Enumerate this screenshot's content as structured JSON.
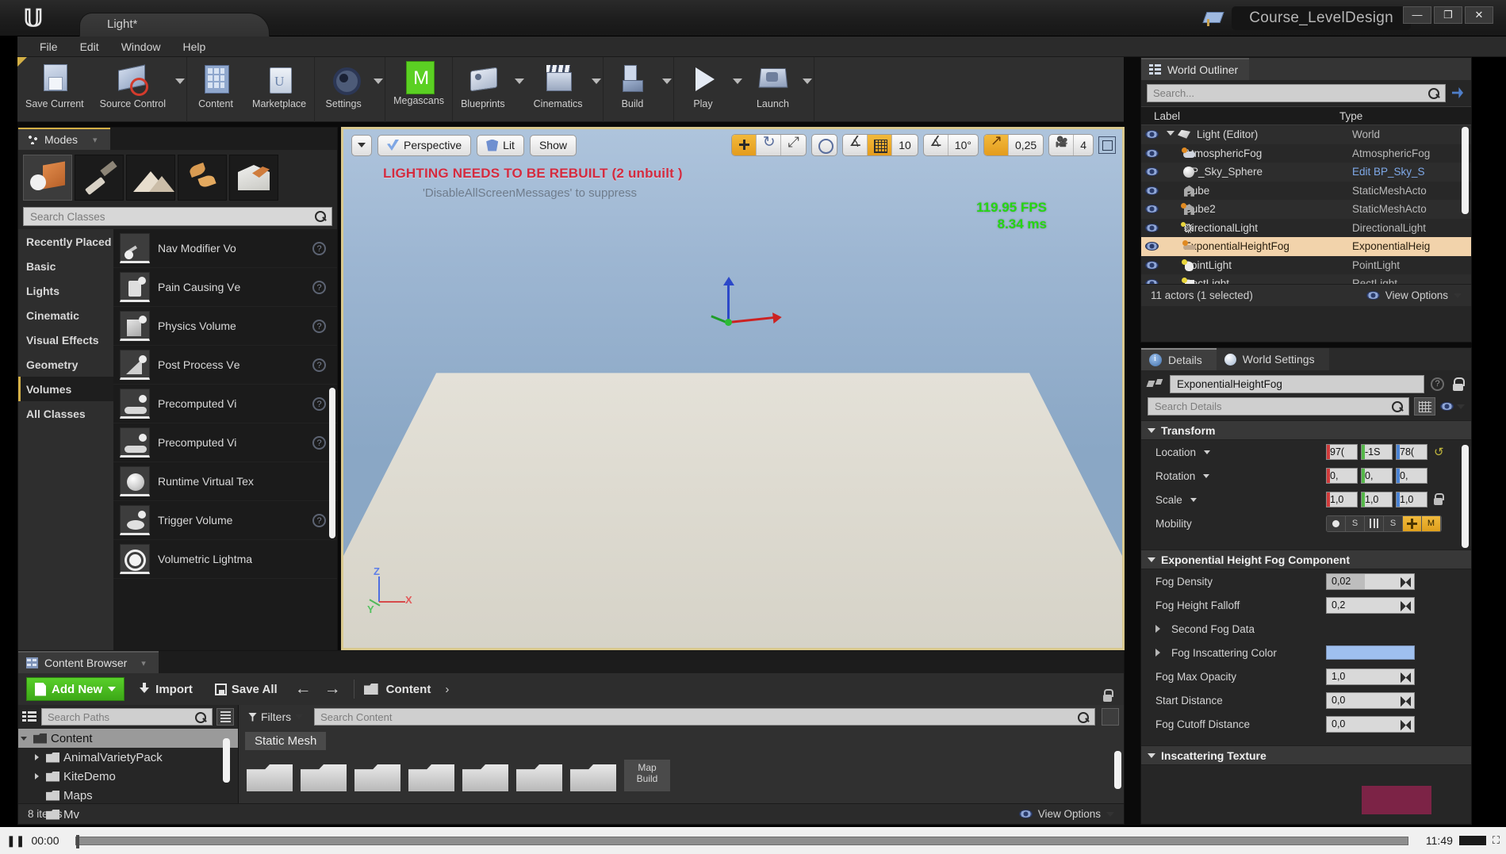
{
  "window": {
    "tab_label": "Light*",
    "project_title": "Course_LevelDesign",
    "minimize": "—",
    "maximize": "❐",
    "close": "✕"
  },
  "menubar": {
    "items": [
      "File",
      "Edit",
      "Window",
      "Help"
    ]
  },
  "toolbar": {
    "items": [
      {
        "label": "Save Current",
        "icon": "save-icon",
        "arrow": false
      },
      {
        "label": "Source Control",
        "icon": "source-control-icon",
        "arrow": true
      },
      {
        "label": "Content",
        "icon": "content-icon",
        "arrow": false
      },
      {
        "label": "Marketplace",
        "icon": "marketplace-icon",
        "arrow": false
      },
      {
        "label": "Settings",
        "icon": "gear-icon",
        "arrow": true
      },
      {
        "label": "Megascans",
        "icon": "megascans-icon",
        "arrow": false
      },
      {
        "label": "Blueprints",
        "icon": "blueprints-icon",
        "arrow": true
      },
      {
        "label": "Cinematics",
        "icon": "cinematics-icon",
        "arrow": true
      },
      {
        "label": "Build",
        "icon": "build-icon",
        "arrow": true
      },
      {
        "label": "Play",
        "icon": "play-icon",
        "arrow": true
      },
      {
        "label": "Launch",
        "icon": "launch-icon",
        "arrow": true
      }
    ]
  },
  "modes": {
    "tab_label": "Modes",
    "mode_buttons": [
      "place-mode-icon",
      "paint-mode-icon",
      "landscape-mode-icon",
      "foliage-mode-icon",
      "geometry-mode-icon"
    ],
    "active_mode_index": 0,
    "search_placeholder": "Search Classes",
    "categories": [
      "Recently Placed",
      "Basic",
      "Lights",
      "Cinematic",
      "Visual Effects",
      "Geometry",
      "Volumes",
      "All Classes"
    ],
    "selected_category": "Volumes",
    "classes": [
      {
        "name": "Nav Modifier Vo",
        "thumb": "ct-a",
        "help": true
      },
      {
        "name": "Pain Causing Vе",
        "thumb": "ct-b",
        "help": true
      },
      {
        "name": "Physics Volume",
        "thumb": "ct-c",
        "help": true
      },
      {
        "name": "Post Process Vе",
        "thumb": "ct-d",
        "help": true
      },
      {
        "name": "Precomputed Vi",
        "thumb": "ct-e",
        "help": true
      },
      {
        "name": "Precomputed Vi",
        "thumb": "ct-e",
        "help": true
      },
      {
        "name": "Runtime Virtual Teх",
        "thumb": "ct-f",
        "help": false
      },
      {
        "name": "Trigger Volume",
        "thumb": "ct-g",
        "help": true
      },
      {
        "name": "Volumetric Lightma",
        "thumb": "ct-h",
        "help": false
      }
    ]
  },
  "viewport": {
    "view_dropdown": "▾",
    "perspective_label": "Perspective",
    "lit_label": "Lit",
    "show_label": "Show",
    "warning_line1": "LIGHTING NEEDS TO BE REBUILT (2 unbuilt )",
    "warning_line2": "'DisableAllScreenMessages' to suppress",
    "fps": "119.95 FPS",
    "frametime": "8.34 ms",
    "grid_snap_value": "10",
    "angle_snap_value": "10°",
    "scale_snap_value": "0,25",
    "camera_speed_value": "4",
    "axis_z": "Z",
    "axis_x": "X",
    "axis_y": "Y"
  },
  "outliner": {
    "tab_label": "World Outliner",
    "search_placeholder": "Search...",
    "col_label": "Label",
    "col_type": "Type",
    "rows": [
      {
        "label": "Light (Editor)",
        "type": "World",
        "indent": 1,
        "icon": "oi-world",
        "expander": true,
        "selected": false,
        "link": false
      },
      {
        "label": "AtmosphericFog",
        "type": "AtmosphericFog",
        "indent": 2,
        "icon": "oi-fog",
        "expander": false,
        "selected": false,
        "link": false
      },
      {
        "label": "BP_Sky_Sphere",
        "type": "Edit BP_Sky_S",
        "indent": 2,
        "icon": "oi-sphere",
        "expander": false,
        "selected": false,
        "link": true
      },
      {
        "label": "Cube",
        "type": "StaticMeshActo",
        "indent": 2,
        "icon": "oi-mesh",
        "expander": false,
        "selected": false,
        "link": false
      },
      {
        "label": "Cube2",
        "type": "StaticMeshActo",
        "indent": 2,
        "icon": "oi-mesh oi-mesh2",
        "expander": false,
        "selected": false,
        "link": false
      },
      {
        "label": "DirectionalLight",
        "type": "DirectionalLight",
        "indent": 2,
        "icon": "oi-dirl",
        "expander": false,
        "selected": false,
        "link": false
      },
      {
        "label": "ExponentialHeightFog",
        "type": "ExponentialHeig",
        "indent": 2,
        "icon": "oi-expfog",
        "expander": false,
        "selected": true,
        "link": false
      },
      {
        "label": "PointLight",
        "type": "PointLight",
        "indent": 2,
        "icon": "oi-point",
        "expander": false,
        "selected": false,
        "link": false
      },
      {
        "label": "RectLight",
        "type": "RectLight",
        "indent": 2,
        "icon": "oi-rect",
        "expander": false,
        "selected": false,
        "link": false
      }
    ],
    "status": "11 actors (1 selected)",
    "view_options": "View Options"
  },
  "details": {
    "tabs": [
      {
        "label": "Details",
        "icon": "details-icon",
        "active": true
      },
      {
        "label": "World Settings",
        "icon": "world-settings-icon",
        "active": false
      }
    ],
    "actor_name": "ExponentialHeightFog",
    "search_placeholder": "Search Details",
    "transform": {
      "title": "Transform",
      "rows": [
        {
          "label": "Location",
          "values": [
            "97(",
            "-1Ѕ",
            "78("
          ]
        },
        {
          "label": "Rotation",
          "values": [
            "0,",
            "0,",
            "0,"
          ]
        },
        {
          "label": "Scale",
          "values": [
            "1,0",
            "1,0",
            "1,0"
          ]
        }
      ],
      "mobility_label": "Mobility",
      "mobility_options": [
        "Static",
        "S",
        "Stationary",
        "S",
        "Movable",
        "M"
      ]
    },
    "fog_component": {
      "title": "Exponential Height Fog Component",
      "rows": [
        {
          "label": "Fog Density",
          "value": "0,02",
          "kind": "number-filled"
        },
        {
          "label": "Fog Height Falloff",
          "value": "0,2",
          "kind": "number"
        },
        {
          "label": "Second Fog Data",
          "value": "",
          "kind": "group"
        },
        {
          "label": "Fog Inscattering Color",
          "value": "#9fc0ef",
          "kind": "color"
        },
        {
          "label": "Fog Max Opacity",
          "value": "1,0",
          "kind": "number"
        },
        {
          "label": "Start Distance",
          "value": "0,0",
          "kind": "number"
        },
        {
          "label": "Fog Cutoff Distance",
          "value": "0,0",
          "kind": "number"
        }
      ]
    },
    "inscattering": {
      "title": "Inscattering Texture"
    }
  },
  "content_browser": {
    "tab_label": "Content Browser",
    "add_new": "Add New",
    "import": "Import",
    "save_all": "Save All",
    "breadcrumb": "Content",
    "paths_placeholder": "Search Paths",
    "content_placeholder": "Search Content",
    "filters_label": "Filters",
    "filter_chip": "Static Mesh",
    "tree": [
      {
        "label": "Content",
        "indent": 0,
        "expanded": true,
        "selected": true
      },
      {
        "label": "AnimalVarietyPack",
        "indent": 1,
        "expanded": false,
        "selected": false
      },
      {
        "label": "KiteDemo",
        "indent": 1,
        "expanded": false,
        "selected": false
      },
      {
        "label": "Maps",
        "indent": 1,
        "expanded": null,
        "selected": false
      },
      {
        "label": "Mv",
        "indent": 1,
        "expanded": null,
        "selected": false
      }
    ],
    "assets": [
      "folder",
      "folder",
      "folder",
      "folder",
      "folder",
      "folder",
      "folder"
    ],
    "map_build_label": "Map\nBuild",
    "item_count": "8 items",
    "view_options": "View Options"
  },
  "media_bar": {
    "play_glyph": "❚❚",
    "current_time": "00:00",
    "total_time": "11:49",
    "fullscreen_glyph": "⛶"
  },
  "colors": {
    "accent_gold": "#d4b046",
    "selection_peach": "#f2d3ab",
    "green_button": "#3da817",
    "fps_green": "#25d712",
    "warning_red": "#d42b3f",
    "fog_color": "#9fc0ef"
  }
}
